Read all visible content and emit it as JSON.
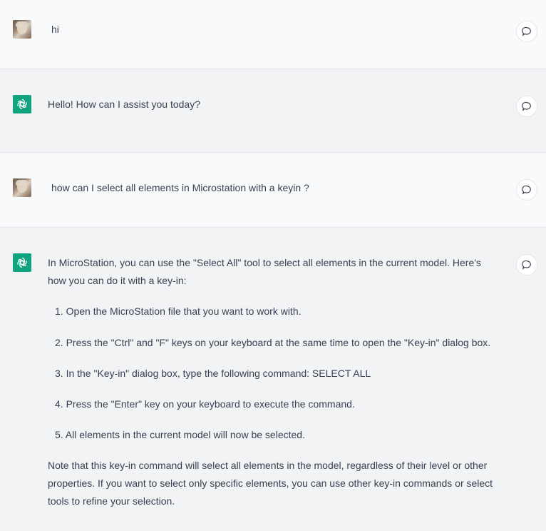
{
  "conversation": [
    {
      "role": "user",
      "avatar": "user-photo-avatar",
      "text": "hi"
    },
    {
      "role": "assistant",
      "avatar": "openai-logo-icon",
      "text": "Hello! How can I assist you today?"
    },
    {
      "role": "user",
      "avatar": "user-photo-avatar",
      "text": "how can I select all elements in Microstation with a keyin ?"
    },
    {
      "role": "assistant",
      "avatar": "openai-logo-icon",
      "intro_line1": "In MicroStation, you can use the \"Select All\" tool to select all elements in the current model. Here's",
      "intro_line2": "how you can do it with a key-in:",
      "steps": [
        "1. Open the MicroStation file that you want to work with.",
        "2. Press the \"Ctrl\" and \"F\" keys on your keyboard at the same time to open the \"Key-in\" dialog box.",
        "3. In the \"Key-in\" dialog box, type the following command: SELECT ALL",
        "4. Press the \"Enter\" key on your keyboard to execute the command.",
        "5. All elements in the current model will now be selected."
      ],
      "note_line1": "Note that this key-in command will select all elements in the model, regardless of their level or other",
      "note_line2": "properties. If you want to select only specific elements, you can use other key-in commands or select",
      "note_line3": "tools to refine your selection."
    }
  ],
  "icons": {
    "comment_button": "speech-bubble-icon"
  },
  "colors": {
    "assistant_logo_bg": "#10a37f",
    "user_row_bg": "#f9fafb",
    "assistant_row_bg": "#f2f3f5"
  }
}
